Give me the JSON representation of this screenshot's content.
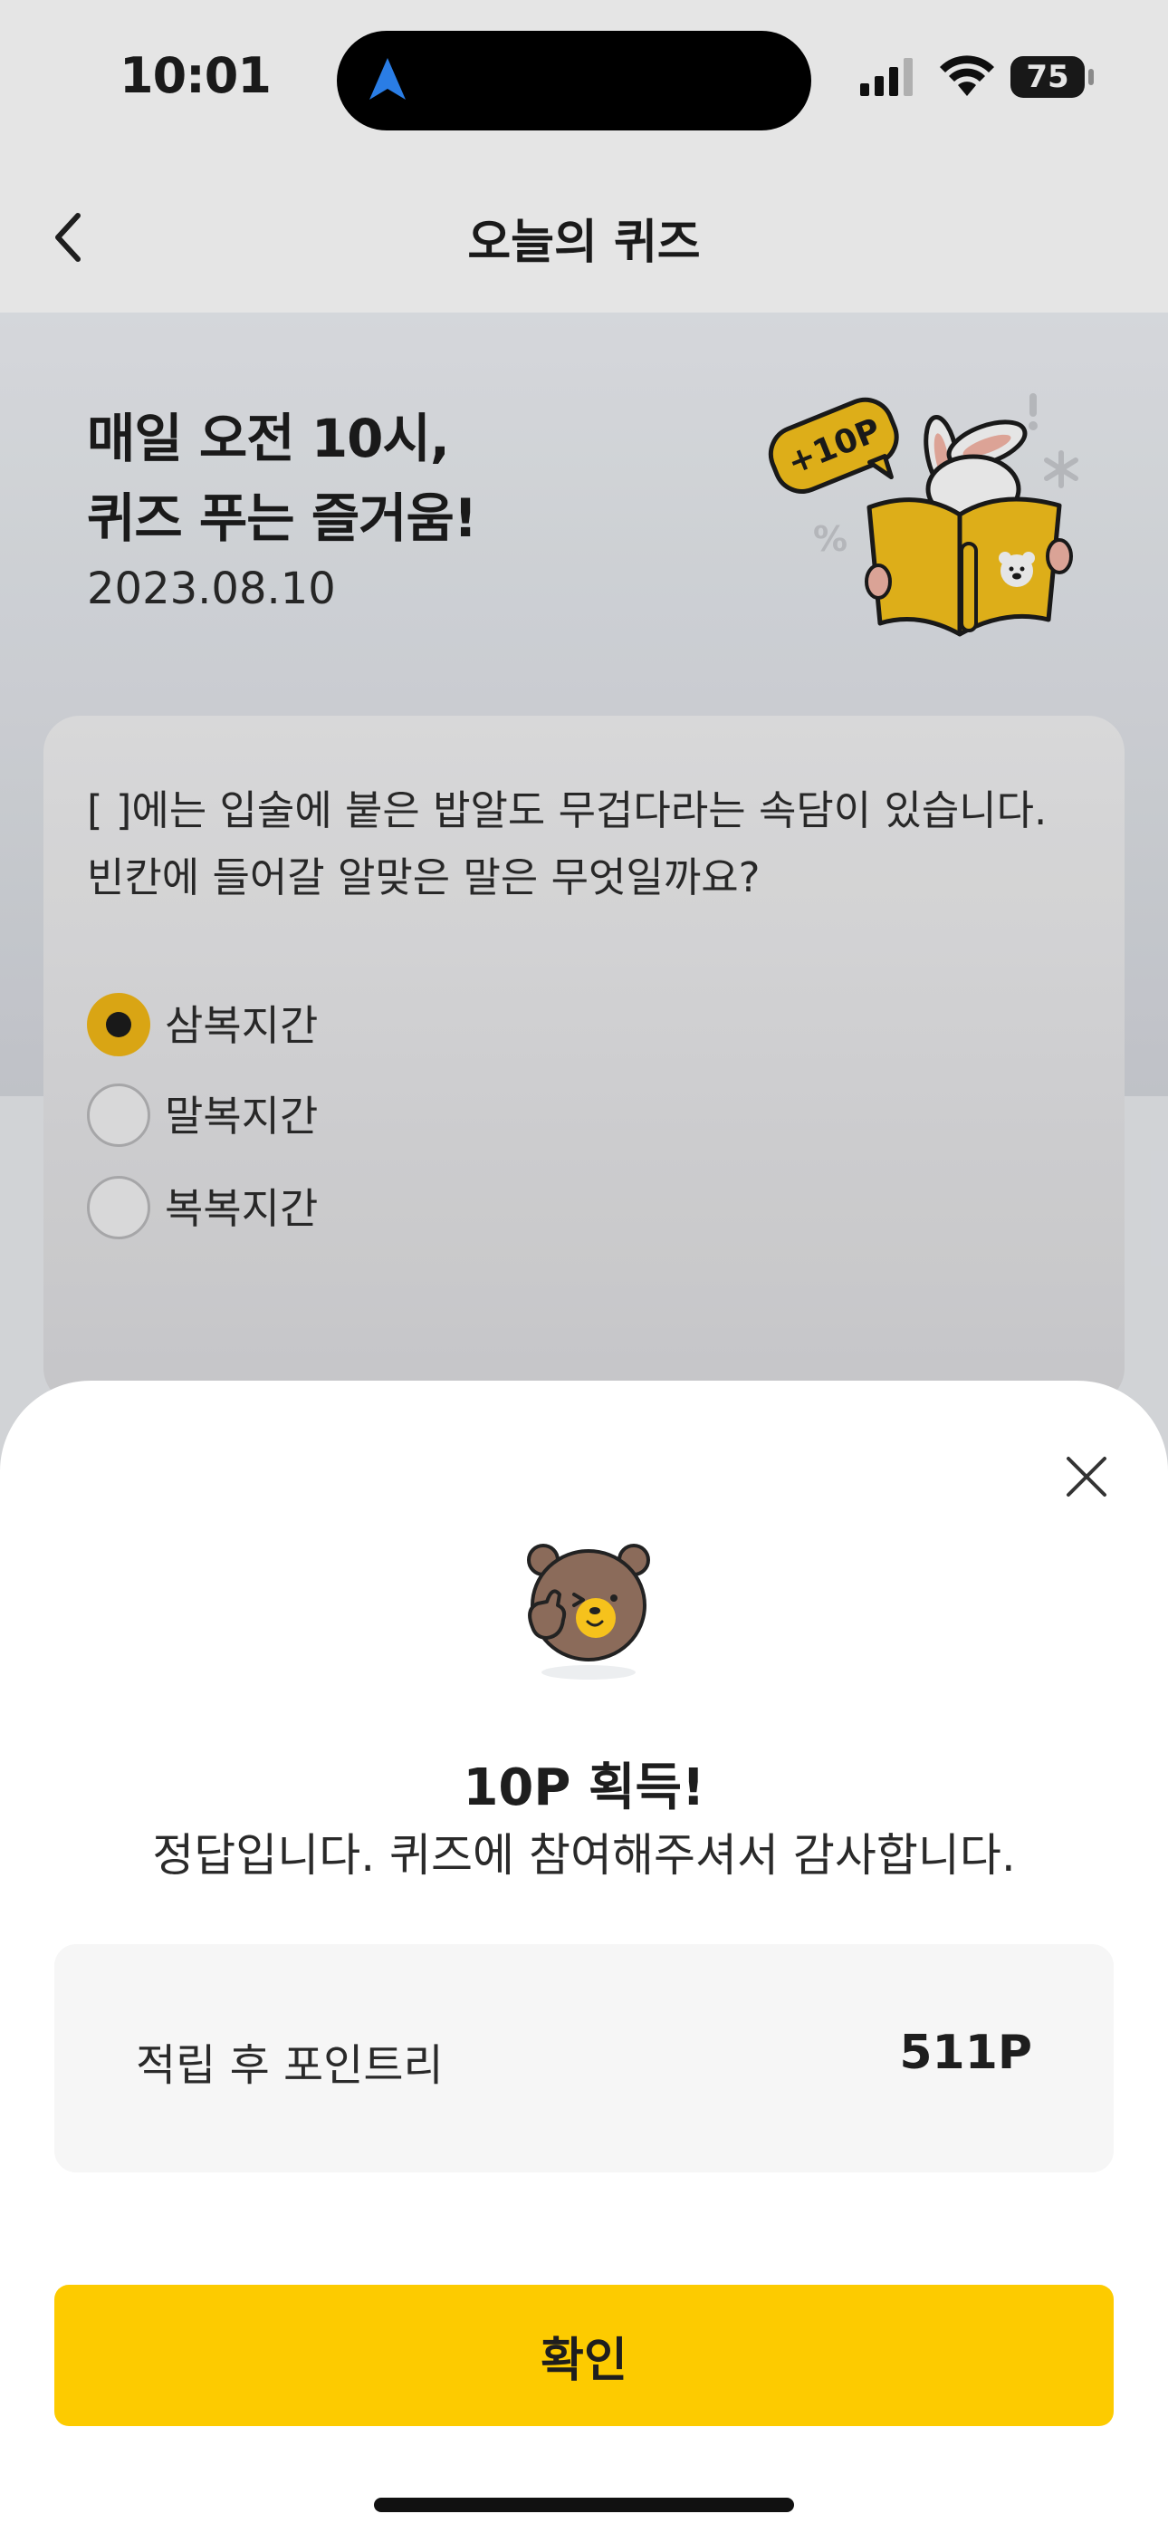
{
  "status_bar": {
    "time": "10:01",
    "battery": "75",
    "icons": [
      "location-arrow-icon",
      "cellular-signal-icon",
      "wifi-icon",
      "battery-icon"
    ]
  },
  "header": {
    "title": "오늘의 퀴즈",
    "back_icon": "chevron-left-icon"
  },
  "hero": {
    "title_line1": "매일 오전 10시,",
    "title_line2": "퀴즈 푸는 즐거움!",
    "date": "2023.08.10",
    "illustration_badge": "+10P"
  },
  "quiz": {
    "question_line1": "[ ]에는 입술에 붙은 밥알도 무겁다라는 속담이 있습니다.",
    "question_line2": "빈칸에 들어갈 알맞은 말은 무엇일까요?",
    "options": [
      {
        "label": "삼복지간",
        "selected": true
      },
      {
        "label": "말복지간",
        "selected": false
      },
      {
        "label": "복복지간",
        "selected": false
      }
    ]
  },
  "sheet": {
    "close_icon": "close-icon",
    "reward_title": "10P 획득!",
    "reward_desc": "정답입니다. 퀴즈에 참여해주셔서 감사합니다.",
    "point_label": "적립 후 포인트리",
    "point_value": "511P",
    "confirm_label": "확인"
  },
  "colors": {
    "accent": "#fdcb00",
    "radio_selected": "#f2b817",
    "hero_bg_top": "#edf0f4",
    "hero_bg_bottom": "#d5d8de"
  }
}
